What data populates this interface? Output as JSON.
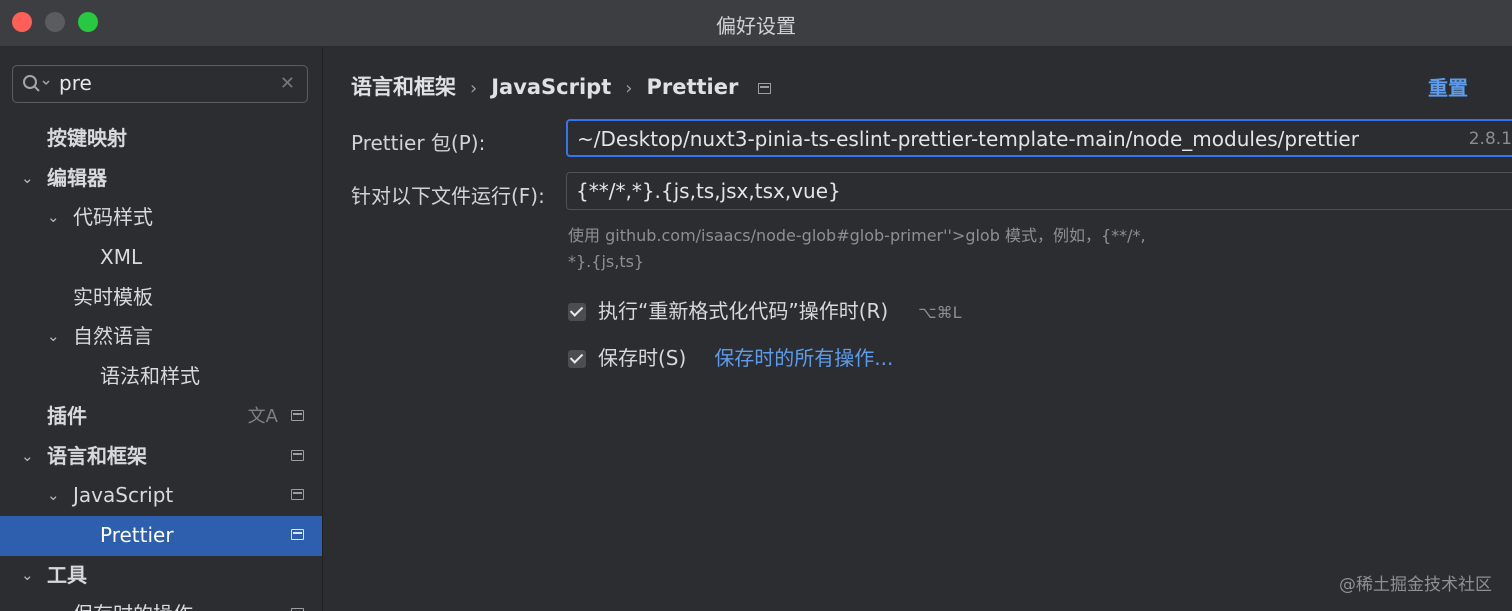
{
  "window": {
    "title": "偏好设置"
  },
  "search": {
    "value": "pre",
    "placeholder": ""
  },
  "sidebar": {
    "items": [
      {
        "label": "按键映射",
        "chevron": ""
      },
      {
        "label": "编辑器",
        "chevron": "⌄"
      },
      {
        "label": "代码样式",
        "chevron": "⌄"
      },
      {
        "label": "XML",
        "chevron": ""
      },
      {
        "label": "实时模板",
        "chevron": ""
      },
      {
        "label": "自然语言",
        "chevron": "⌄"
      },
      {
        "label": "语法和样式",
        "chevron": ""
      },
      {
        "label": "插件",
        "chevron": "",
        "translate_icon": "文A"
      },
      {
        "label": "语言和框架",
        "chevron": "⌄"
      },
      {
        "label": "JavaScript",
        "chevron": "⌄"
      },
      {
        "label": "Prettier",
        "chevron": ""
      },
      {
        "label": "工具",
        "chevron": "⌄"
      },
      {
        "label": "保存时的操作",
        "chevron": ""
      }
    ]
  },
  "breadcrumb": {
    "items": [
      "语言和框架",
      "JavaScript",
      "Prettier"
    ],
    "separator": "›"
  },
  "header": {
    "reset_label": "重置"
  },
  "form": {
    "package_label": "Prettier 包(P):",
    "package_value": "~/Desktop/nuxt3-pinia-ts-eslint-prettier-template-main/node_modules/prettier",
    "package_version": "2.8.1",
    "files_label": "针对以下文件运行(F):",
    "files_value": "{**/*,*}.{js,ts,jsx,tsx,vue}",
    "hint_line1": "使用 github.com/isaacs/node-glob#glob-primer''>glob 模式，例如，{**/*,",
    "hint_line2": "*}.{js,ts}",
    "reformat_label": "执行“重新格式化代码”操作时(R)",
    "reformat_checked": true,
    "reformat_shortcut": "⌥⌘L",
    "save_label": "保存时(S)",
    "save_checked": true,
    "save_link": "保存时的所有操作..."
  },
  "watermark": "@稀土掘金技术社区",
  "colors": {
    "accent": "#5d9cec",
    "selection": "#2e5fae",
    "focus_border": "#3574f0"
  }
}
